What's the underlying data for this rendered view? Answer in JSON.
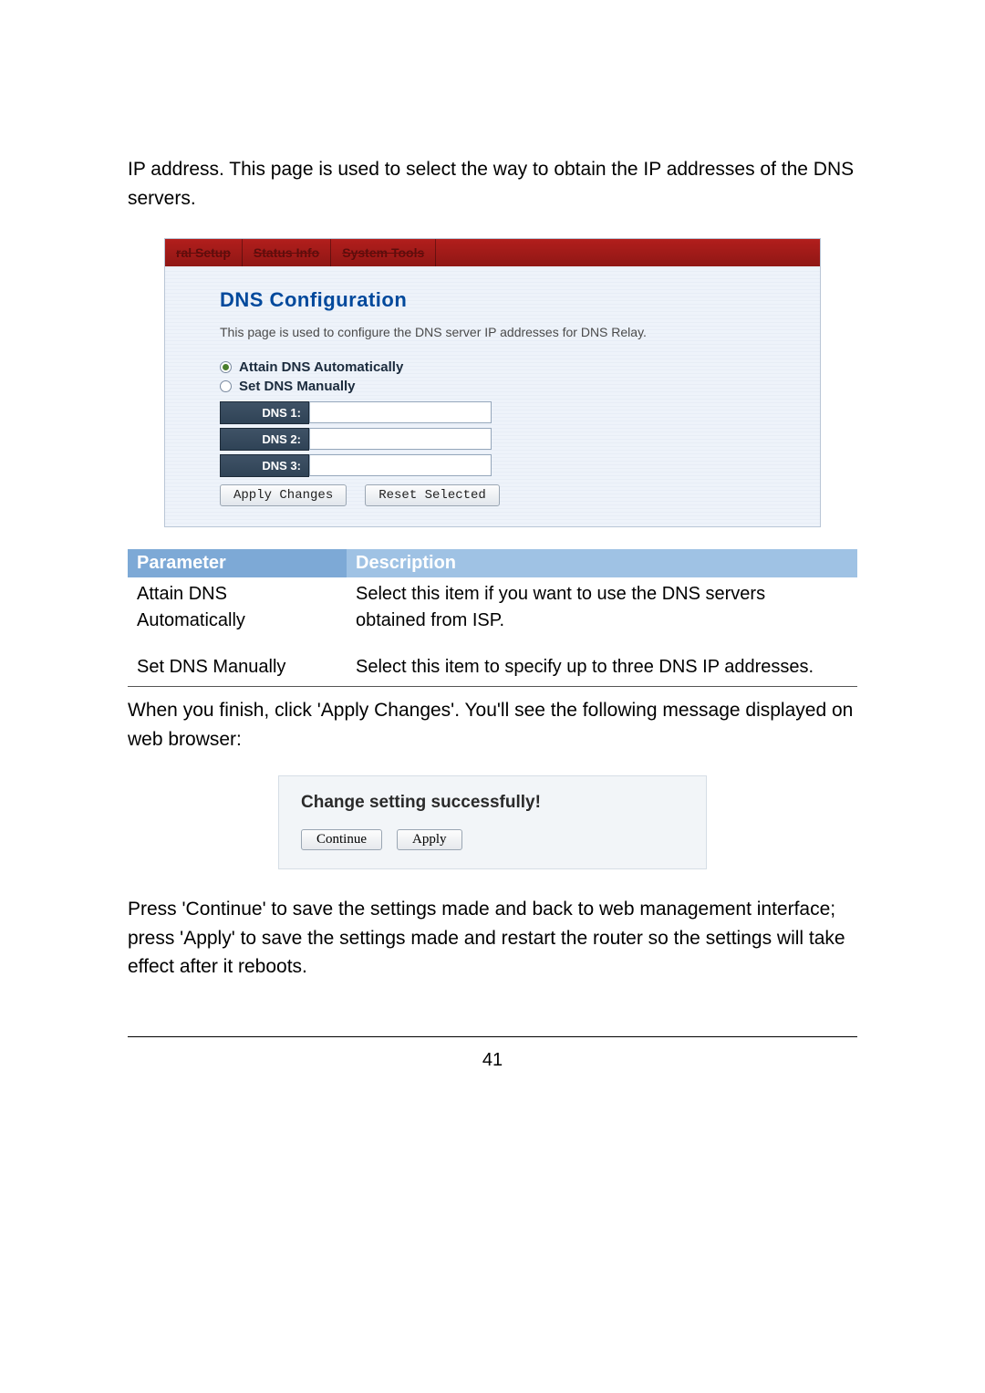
{
  "intro": "IP address. This page is used to select the way to obtain the IP addresses of the DNS servers.",
  "tabs": {
    "t1": "ral Setup",
    "t2": "Status Info",
    "t3": "System Tools"
  },
  "panel": {
    "title": "DNS Configuration",
    "sub": "This page is used to configure the DNS server IP addresses for DNS Relay.",
    "opt_auto": "Attain DNS Automatically",
    "opt_manual": "Set DNS Manually",
    "dns1": "DNS 1:",
    "dns2": "DNS 2:",
    "dns3": "DNS 3:",
    "btn_apply": "Apply Changes",
    "btn_reset": "Reset Selected"
  },
  "table": {
    "h1": "Parameter",
    "h2": "Description",
    "r1c1a": "Attain DNS",
    "r1c1b": "Automatically",
    "r1c2a": "Select this item if you want to use the DNS servers",
    "r1c2b": "obtained from ISP.",
    "r2c1": "Set DNS Manually",
    "r2c2": "Select this item to specify up to three DNS IP addresses."
  },
  "para2": "When you finish, click 'Apply Changes'. You'll see the following message displayed on web browser:",
  "shot2": {
    "title": "Change setting successfully!",
    "continue": "Continue",
    "apply": "Apply"
  },
  "para3": "Press 'Continue' to save the settings made and back to web management interface; press 'Apply' to save the settings made and restart the router so the settings will take effect after it reboots.",
  "pageno": "41"
}
